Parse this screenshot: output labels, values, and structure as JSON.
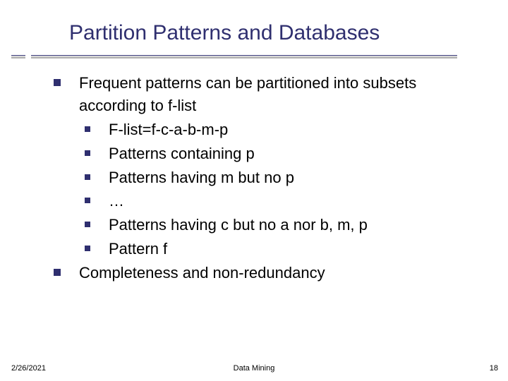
{
  "title": "Partition Patterns and Databases",
  "bullets_lvl1": {
    "b1": "Frequent patterns can be partitioned into subsets according to f-list",
    "b2": "Completeness and non-redundancy"
  },
  "bullets_lvl2": {
    "s1": "F-list=f-c-a-b-m-p",
    "s2": "Patterns containing p",
    "s3": "Patterns having m but no p",
    "s4": "…",
    "s5": "Patterns having c but no a nor b, m, p",
    "s6": "Pattern f"
  },
  "footer": {
    "date": "2/26/2021",
    "center": "Data Mining",
    "page": "18"
  }
}
